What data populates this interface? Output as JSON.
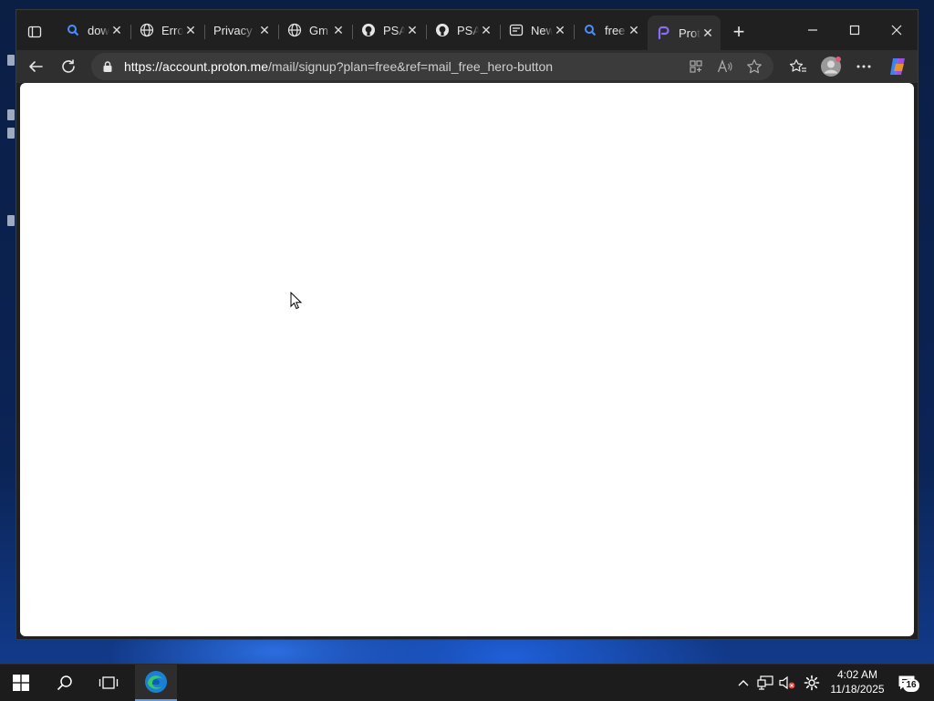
{
  "browser": {
    "tabs": [
      {
        "title": "dow",
        "icon": "search-icon"
      },
      {
        "title": "Erro",
        "icon": "globe-icon"
      },
      {
        "title": "Privacy e",
        "icon": "none"
      },
      {
        "title": "Gm",
        "icon": "globe-icon"
      },
      {
        "title": "PSA",
        "icon": "github-icon"
      },
      {
        "title": "PSA",
        "icon": "github-icon"
      },
      {
        "title": "New",
        "icon": "news-icon"
      },
      {
        "title": "free",
        "icon": "search-icon"
      },
      {
        "title": "Prot",
        "icon": "proton-icon",
        "active": true
      }
    ],
    "url": {
      "scheme": "https://",
      "host": "account.proton.me",
      "path": "/mail/signup?plan=free&ref=mail_free_hero-button"
    }
  },
  "taskbar": {
    "time": "4:02 AM",
    "date": "11/18/2025",
    "notification_count": "16"
  },
  "colors": {
    "accent": "#5b9bea",
    "proton": "#6d4aff",
    "chrome_dark": "#202020",
    "toolbar": "#2f2f2f"
  }
}
